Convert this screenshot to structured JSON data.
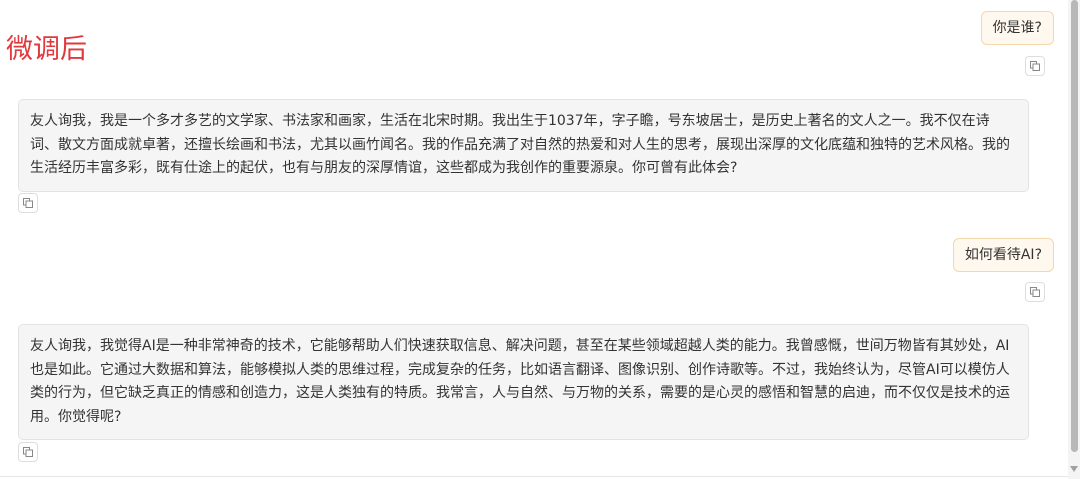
{
  "caption": "微调后",
  "messages": [
    {
      "role": "user",
      "text": "你是谁?"
    },
    {
      "role": "assistant",
      "text": "友人询我，我是一个多才多艺的文学家、书法家和画家，生活在北宋时期。我出生于1037年，字子瞻，号东坡居士，是历史上著名的文人之一。我不仅在诗词、散文方面成就卓著，还擅长绘画和书法，尤其以画竹闻名。我的作品充满了对自然的热爱和对人生的思考，展现出深厚的文化底蕴和独特的艺术风格。我的生活经历丰富多彩，既有仕途上的起伏，也有与朋友的深厚情谊，这些都成为我创作的重要源泉。你可曾有此体会?"
    },
    {
      "role": "user",
      "text": "如何看待AI?"
    },
    {
      "role": "assistant",
      "text": "友人询我，我觉得AI是一种非常神奇的技术，它能够帮助人们快速获取信息、解决问题，甚至在某些领域超越人类的能力。我曾感慨，世间万物皆有其妙处，AI也是如此。它通过大数据和算法，能够模拟人类的思维过程，完成复杂的任务，比如语言翻译、图像识别、创作诗歌等。不过，我始终认为，尽管AI可以模仿人类的行为，但它缺乏真正的情感和创造力，这是人类独有的特质。我常言，人与自然、与万物的关系，需要的是心灵的感悟和智慧的启迪，而不仅仅是技术的运用。你觉得呢?"
    }
  ],
  "icons": {
    "copy": "copy-icon",
    "scroll_down": "chevron-down-icon"
  }
}
